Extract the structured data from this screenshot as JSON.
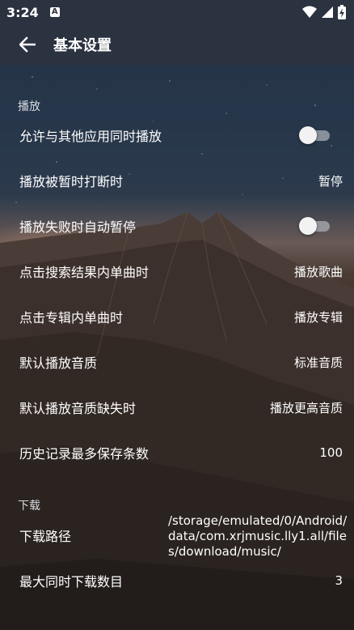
{
  "status_bar": {
    "time": "3:24",
    "app_icon_letter": "A",
    "icons": [
      "wifi-icon",
      "signal-icon",
      "battery-charging-icon"
    ]
  },
  "app_bar": {
    "title": "基本设置",
    "back_icon": "arrow-left-icon"
  },
  "sections": {
    "playback": {
      "title": "播放",
      "allow_simultaneous": {
        "label": "允许与其他应用同时播放",
        "enabled": false
      },
      "interrupted": {
        "label": "播放被暂时打断时",
        "value": "暂停"
      },
      "auto_pause_on_fail": {
        "label": "播放失败时自动暂停",
        "enabled": false
      },
      "search_tap": {
        "label": "点击搜索结果内单曲时",
        "value": "播放歌曲"
      },
      "album_tap": {
        "label": "点击专辑内单曲时",
        "value": "播放专辑"
      },
      "default_quality": {
        "label": "默认播放音质",
        "value": "标准音质"
      },
      "quality_missing": {
        "label": "默认播放音质缺失时",
        "value": "播放更高音质"
      },
      "history_max": {
        "label": "历史记录最多保存条数",
        "value": "100"
      }
    },
    "download": {
      "title": "下载",
      "path": {
        "label": "下载路径",
        "value": "/storage/emulated/0/Android/data/com.xrjmusic.lly1.all/files/download/music/"
      },
      "max_concurrent": {
        "label": "最大同时下载数目",
        "value": "3"
      }
    }
  }
}
